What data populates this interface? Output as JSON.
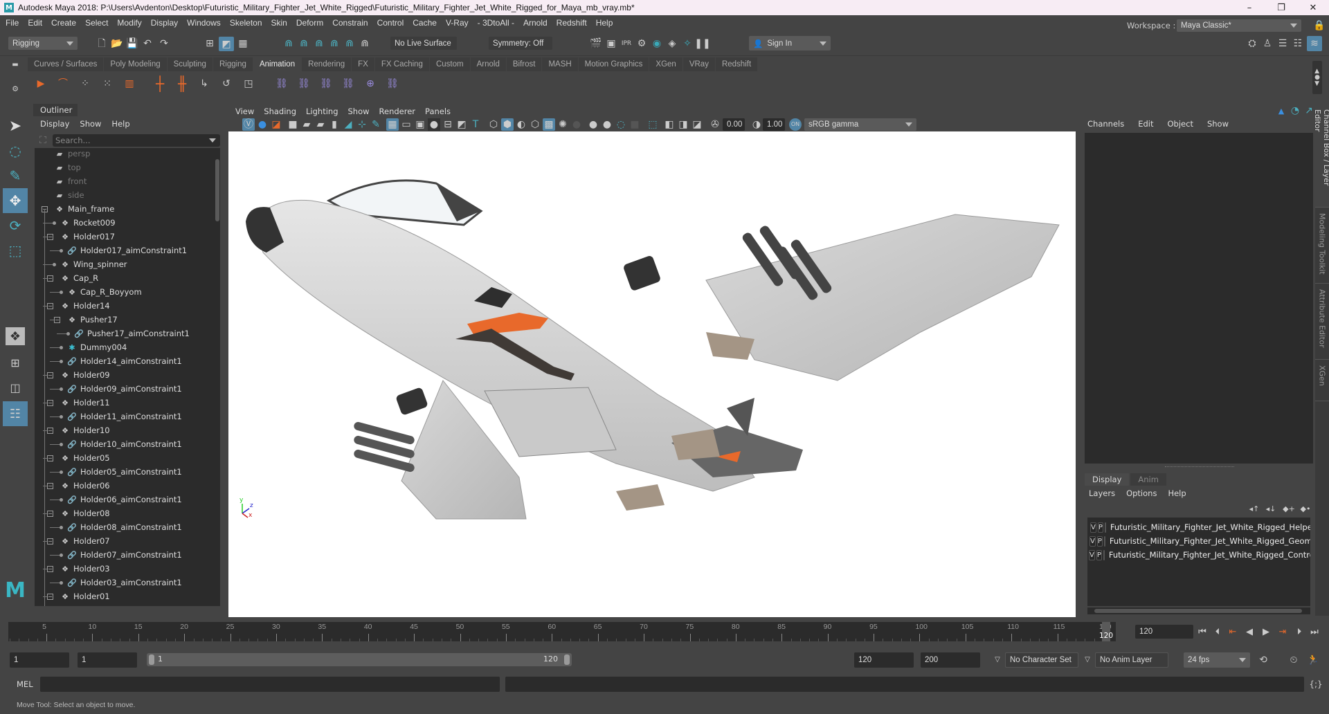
{
  "window": {
    "title": "Autodesk Maya 2018: P:\\Users\\Avdenton\\Desktop\\Futuristic_Military_Fighter_Jet_White_Rigged\\Futuristic_Military_Fighter_Jet_White_Rigged_for_Maya_mb_vray.mb*",
    "logo": "M",
    "minimize": "–",
    "restore": "❐",
    "close": "✕"
  },
  "menubar": [
    "File",
    "Edit",
    "Create",
    "Select",
    "Modify",
    "Display",
    "Windows",
    "Skeleton",
    "Skin",
    "Deform",
    "Constrain",
    "Control",
    "Cache",
    "V-Ray",
    "- 3DtoAll -",
    "Arnold",
    "Redshift",
    "Help"
  ],
  "statusline": {
    "menuset": "Rigging",
    "live_surface": "No Live Surface",
    "symmetry": "Symmetry: Off",
    "sign_in": "Sign In",
    "workspace_label": "Workspace :",
    "workspace": "Maya Classic*"
  },
  "shelf": {
    "tabs": [
      "Curves / Surfaces",
      "Poly Modeling",
      "Sculpting",
      "Rigging",
      "Animation",
      "Rendering",
      "FX",
      "FX Caching",
      "Custom",
      "Arnold",
      "Bifrost",
      "MASH",
      "Motion Graphics",
      "XGen",
      "VRay",
      "Redshift"
    ],
    "active_tab": "Animation"
  },
  "outliner": {
    "title": "Outliner",
    "menu": [
      "Display",
      "Show",
      "Help"
    ],
    "search_placeholder": "Search...",
    "items": [
      {
        "label": "persp",
        "type": "camera",
        "depth": 0,
        "dim": true
      },
      {
        "label": "top",
        "type": "camera",
        "depth": 0,
        "dim": true
      },
      {
        "label": "front",
        "type": "camera",
        "depth": 0,
        "dim": true
      },
      {
        "label": "side",
        "type": "camera",
        "depth": 0,
        "dim": true
      },
      {
        "label": "Main_frame",
        "type": "transform",
        "depth": 0,
        "expanded": true
      },
      {
        "label": "Rocket009",
        "type": "transform",
        "depth": 1
      },
      {
        "label": "Holder017",
        "type": "transform",
        "depth": 1,
        "expanded": true
      },
      {
        "label": "Holder017_aimConstraint1",
        "type": "constraint",
        "depth": 2
      },
      {
        "label": "Wing_spinner",
        "type": "transform",
        "depth": 1
      },
      {
        "label": "Cap_R",
        "type": "transform",
        "depth": 1,
        "expanded": true
      },
      {
        "label": "Cap_R_Boyyom",
        "type": "transform",
        "depth": 2
      },
      {
        "label": "Holder14",
        "type": "transform",
        "depth": 1,
        "expanded": true
      },
      {
        "label": "Pusher17",
        "type": "transform",
        "depth": 2,
        "expanded": true
      },
      {
        "label": "Pusher17_aimConstraint1",
        "type": "constraint",
        "depth": 3
      },
      {
        "label": "Dummy004",
        "type": "locator",
        "depth": 2
      },
      {
        "label": "Holder14_aimConstraint1",
        "type": "constraint",
        "depth": 2
      },
      {
        "label": "Holder09",
        "type": "transform",
        "depth": 1,
        "expanded": true
      },
      {
        "label": "Holder09_aimConstraint1",
        "type": "constraint",
        "depth": 2
      },
      {
        "label": "Holder11",
        "type": "transform",
        "depth": 1,
        "expanded": true
      },
      {
        "label": "Holder11_aimConstraint1",
        "type": "constraint",
        "depth": 2
      },
      {
        "label": "Holder10",
        "type": "transform",
        "depth": 1,
        "expanded": true
      },
      {
        "label": "Holder10_aimConstraint1",
        "type": "constraint",
        "depth": 2
      },
      {
        "label": "Holder05",
        "type": "transform",
        "depth": 1,
        "expanded": true
      },
      {
        "label": "Holder05_aimConstraint1",
        "type": "constraint",
        "depth": 2
      },
      {
        "label": "Holder06",
        "type": "transform",
        "depth": 1,
        "expanded": true
      },
      {
        "label": "Holder06_aimConstraint1",
        "type": "constraint",
        "depth": 2
      },
      {
        "label": "Holder08",
        "type": "transform",
        "depth": 1,
        "expanded": true
      },
      {
        "label": "Holder08_aimConstraint1",
        "type": "constraint",
        "depth": 2
      },
      {
        "label": "Holder07",
        "type": "transform",
        "depth": 1,
        "expanded": true
      },
      {
        "label": "Holder07_aimConstraint1",
        "type": "constraint",
        "depth": 2
      },
      {
        "label": "Holder03",
        "type": "transform",
        "depth": 1,
        "expanded": true
      },
      {
        "label": "Holder03_aimConstraint1",
        "type": "constraint",
        "depth": 2
      },
      {
        "label": "Holder01",
        "type": "transform",
        "depth": 1,
        "expanded": true
      }
    ]
  },
  "viewport": {
    "menu": [
      "View",
      "Shading",
      "Lighting",
      "Show",
      "Renderer",
      "Panels"
    ],
    "exposure": "0.00",
    "gamma": "1.00",
    "color_space": "sRGB gamma",
    "axis": {
      "x": "x",
      "y": "y",
      "z": "z"
    }
  },
  "channelbox": {
    "menu": [
      "Channels",
      "Edit",
      "Object",
      "Show"
    ],
    "layer_tabs": [
      "Display",
      "Anim"
    ],
    "active_layer_tab": "Display",
    "layer_menu": [
      "Layers",
      "Options",
      "Help"
    ],
    "layers": [
      {
        "v": "V",
        "p": "P",
        "color": "#0000ff",
        "name": "Futuristic_Military_Fighter_Jet_White_Rigged_Helpers"
      },
      {
        "v": "V",
        "p": "P",
        "color": "#000066",
        "name": "Futuristic_Military_Fighter_Jet_White_Rigged_Geometry"
      },
      {
        "v": "V",
        "p": "P",
        "color": "#99002e",
        "name": "Futuristic_Military_Fighter_Jet_White_Rigged_Controllers"
      }
    ]
  },
  "side_tabs": [
    "Channel Box / Layer Editor",
    "Modeling Toolkit",
    "Attribute Editor",
    "XGen"
  ],
  "timeline": {
    "ticks": [
      5,
      10,
      15,
      20,
      25,
      30,
      35,
      40,
      45,
      50,
      55,
      60,
      65,
      70,
      75,
      80,
      85,
      90,
      95,
      100,
      105,
      110,
      115,
      120
    ],
    "start": 1,
    "end": 120,
    "current_frame": "120",
    "current_marker": "120"
  },
  "range": {
    "start_field": "1",
    "playback_start": "1",
    "slider_start": "1",
    "slider_end": "120",
    "playback_end": "120",
    "end_field": "200",
    "character_set": "No Character Set",
    "anim_layer": "No Anim Layer",
    "fps": "24 fps"
  },
  "command": {
    "label": "MEL",
    "value": ""
  },
  "helpline": "Move Tool: Select an object to move.",
  "colors": {
    "accent": "#5285a6",
    "orange": "#e8692b",
    "constraint": "#d9393c",
    "locator": "#3cc1d4"
  }
}
